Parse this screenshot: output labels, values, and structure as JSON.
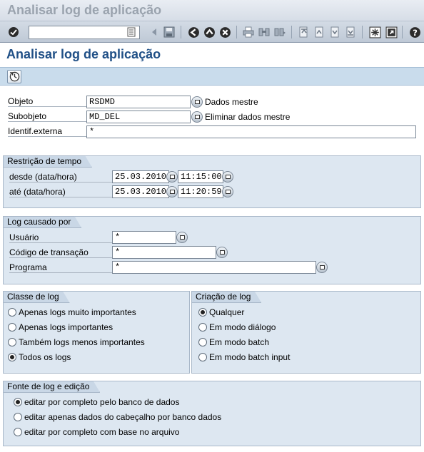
{
  "window": {
    "title": "Analisar log de aplicação"
  },
  "screen": {
    "title": "Analisar log de aplicação"
  },
  "toolbar": {
    "icons": [
      "enter-icon",
      "save-icon",
      "back-icon",
      "exit-icon",
      "cancel-icon",
      "print-icon",
      "find-icon",
      "find-next-icon",
      "first-page-icon",
      "previous-page-icon",
      "next-page-icon",
      "last-page-icon",
      "new-session-icon",
      "shortcut-icon",
      "help-icon"
    ]
  },
  "header": {
    "objeto": {
      "label": "Objeto",
      "value": "RSDMD",
      "description": "Dados mestre"
    },
    "subobjeto": {
      "label": "Subobjeto",
      "value": "MD_DEL",
      "description": "Eliminar dados mestre"
    },
    "identif": {
      "label": "Identif.externa",
      "value": "*"
    }
  },
  "tempo": {
    "title": "Restrição de tempo",
    "desde": {
      "label": "desde (data/hora)",
      "date": "25.03.2010",
      "time": "11:15:00"
    },
    "ate": {
      "label": "até (data/hora)",
      "date": "25.03.2010",
      "time": "11:20:59"
    }
  },
  "causado": {
    "title": "Log causado por",
    "usuario": {
      "label": "Usuário",
      "value": "*"
    },
    "transacao": {
      "label": "Código de transação",
      "value": "*"
    },
    "programa": {
      "label": "Programa",
      "value": "*"
    }
  },
  "classe": {
    "title": "Classe de log",
    "options": [
      {
        "label": "Apenas logs muito importantes",
        "selected": false
      },
      {
        "label": "Apenas logs importantes",
        "selected": false
      },
      {
        "label": "Também logs menos importantes",
        "selected": false
      },
      {
        "label": "Todos os logs",
        "selected": true
      }
    ]
  },
  "criacao": {
    "title": "Criação de log",
    "options": [
      {
        "label": "Qualquer",
        "selected": true
      },
      {
        "label": "Em modo diálogo",
        "selected": false
      },
      {
        "label": "Em modo batch",
        "selected": false
      },
      {
        "label": "Em modo batch input",
        "selected": false
      }
    ]
  },
  "fonte": {
    "title": "Fonte de log e edição",
    "options": [
      {
        "label": "editar por completo pelo banco de dados",
        "selected": true
      },
      {
        "label": "editar apenas dados do cabeçalho por banco dados",
        "selected": false
      },
      {
        "label": "editar por completo com base no arquivo",
        "selected": false
      }
    ]
  }
}
